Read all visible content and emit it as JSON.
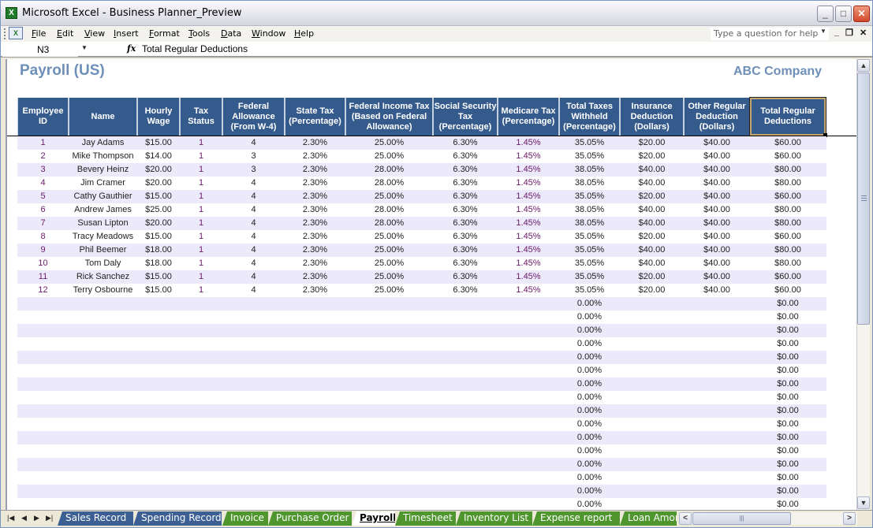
{
  "window": {
    "title": "Microsoft Excel - Business Planner_Preview",
    "minimize": "_",
    "maximize": "□",
    "close": "✕"
  },
  "menu": {
    "items": [
      {
        "key": "F",
        "rest": "ile"
      },
      {
        "key": "E",
        "rest": "dit"
      },
      {
        "key": "V",
        "rest": "iew"
      },
      {
        "key": "I",
        "rest": "nsert"
      },
      {
        "key": "F",
        "pre": "",
        "rest": "ormat",
        "display": "Format"
      },
      {
        "key": "T",
        "rest": "ools"
      },
      {
        "key": "D",
        "rest": "ata"
      },
      {
        "key": "W",
        "rest": "indow"
      },
      {
        "key": "H",
        "rest": "elp"
      }
    ],
    "help_placeholder": "Type a question for help",
    "mdi_min": "_",
    "mdi_restore": "🗗",
    "mdi_close": "✕"
  },
  "formula_bar": {
    "name_box": "N3",
    "fx": "fx",
    "content": "Total Regular Deductions"
  },
  "sheet": {
    "title": "Payroll (US)",
    "company": "ABC Company",
    "selected_cell": "N3",
    "colors": {
      "header_bg": "#355a8c",
      "title_color": "#6e8fb8",
      "band_color": "#ebe9fa"
    },
    "columns": [
      "Employee ID",
      "Name",
      "Hourly Wage",
      "Tax Status",
      "Federal Allowance (From W-4)",
      "State Tax (Percentage)",
      "Federal Income Tax (Based on Federal Allowance)",
      "Social Security Tax (Percentage)",
      "Medicare Tax (Percentage)",
      "Total Taxes Withheld (Percentage)",
      "Insurance Deduction (Dollars)",
      "Other Regular Deduction (Dollars)",
      "Total Regular Deductions"
    ],
    "rows": [
      [
        "1",
        "Jay Adams",
        "$15.00",
        "1",
        "4",
        "2.30%",
        "25.00%",
        "6.30%",
        "1.45%",
        "35.05%",
        "$20.00",
        "$40.00",
        "$60.00"
      ],
      [
        "2",
        "Mike Thompson",
        "$14.00",
        "1",
        "3",
        "2.30%",
        "25.00%",
        "6.30%",
        "1.45%",
        "35.05%",
        "$20.00",
        "$40.00",
        "$60.00"
      ],
      [
        "3",
        "Bevery Heinz",
        "$20.00",
        "1",
        "3",
        "2.30%",
        "28.00%",
        "6.30%",
        "1.45%",
        "38.05%",
        "$40.00",
        "$40.00",
        "$80.00"
      ],
      [
        "4",
        "Jim Cramer",
        "$20.00",
        "1",
        "4",
        "2.30%",
        "28.00%",
        "6.30%",
        "1.45%",
        "38.05%",
        "$40.00",
        "$40.00",
        "$80.00"
      ],
      [
        "5",
        "Cathy Gauthier",
        "$15.00",
        "1",
        "4",
        "2.30%",
        "25.00%",
        "6.30%",
        "1.45%",
        "35.05%",
        "$20.00",
        "$40.00",
        "$60.00"
      ],
      [
        "6",
        "Andrew James",
        "$25.00",
        "1",
        "4",
        "2.30%",
        "28.00%",
        "6.30%",
        "1.45%",
        "38.05%",
        "$40.00",
        "$40.00",
        "$80.00"
      ],
      [
        "7",
        "Susan Lipton",
        "$20.00",
        "1",
        "4",
        "2.30%",
        "28.00%",
        "6.30%",
        "1.45%",
        "38.05%",
        "$40.00",
        "$40.00",
        "$80.00"
      ],
      [
        "8",
        "Tracy Meadows",
        "$15.00",
        "1",
        "4",
        "2.30%",
        "25.00%",
        "6.30%",
        "1.45%",
        "35.05%",
        "$20.00",
        "$40.00",
        "$60.00"
      ],
      [
        "9",
        "Phil Beemer",
        "$18.00",
        "1",
        "4",
        "2.30%",
        "25.00%",
        "6.30%",
        "1.45%",
        "35.05%",
        "$40.00",
        "$40.00",
        "$80.00"
      ],
      [
        "10",
        "Tom Daly",
        "$18.00",
        "1",
        "4",
        "2.30%",
        "25.00%",
        "6.30%",
        "1.45%",
        "35.05%",
        "$40.00",
        "$40.00",
        "$80.00"
      ],
      [
        "11",
        "Rick Sanchez",
        "$15.00",
        "1",
        "4",
        "2.30%",
        "25.00%",
        "6.30%",
        "1.45%",
        "35.05%",
        "$20.00",
        "$40.00",
        "$60.00"
      ],
      [
        "12",
        "Terry Osbourne",
        "$15.00",
        "1",
        "4",
        "2.30%",
        "25.00%",
        "6.30%",
        "1.45%",
        "35.05%",
        "$20.00",
        "$40.00",
        "$60.00"
      ],
      [
        "",
        "",
        "",
        "",
        "",
        "",
        "",
        "",
        "",
        "0.00%",
        "",
        "",
        "$0.00"
      ],
      [
        "",
        "",
        "",
        "",
        "",
        "",
        "",
        "",
        "",
        "0.00%",
        "",
        "",
        "$0.00"
      ],
      [
        "",
        "",
        "",
        "",
        "",
        "",
        "",
        "",
        "",
        "0.00%",
        "",
        "",
        "$0.00"
      ],
      [
        "",
        "",
        "",
        "",
        "",
        "",
        "",
        "",
        "",
        "0.00%",
        "",
        "",
        "$0.00"
      ],
      [
        "",
        "",
        "",
        "",
        "",
        "",
        "",
        "",
        "",
        "0.00%",
        "",
        "",
        "$0.00"
      ],
      [
        "",
        "",
        "",
        "",
        "",
        "",
        "",
        "",
        "",
        "0.00%",
        "",
        "",
        "$0.00"
      ],
      [
        "",
        "",
        "",
        "",
        "",
        "",
        "",
        "",
        "",
        "0.00%",
        "",
        "",
        "$0.00"
      ],
      [
        "",
        "",
        "",
        "",
        "",
        "",
        "",
        "",
        "",
        "0.00%",
        "",
        "",
        "$0.00"
      ],
      [
        "",
        "",
        "",
        "",
        "",
        "",
        "",
        "",
        "",
        "0.00%",
        "",
        "",
        "$0.00"
      ],
      [
        "",
        "",
        "",
        "",
        "",
        "",
        "",
        "",
        "",
        "0.00%",
        "",
        "",
        "$0.00"
      ],
      [
        "",
        "",
        "",
        "",
        "",
        "",
        "",
        "",
        "",
        "0.00%",
        "",
        "",
        "$0.00"
      ],
      [
        "",
        "",
        "",
        "",
        "",
        "",
        "",
        "",
        "",
        "0.00%",
        "",
        "",
        "$0.00"
      ],
      [
        "",
        "",
        "",
        "",
        "",
        "",
        "",
        "",
        "",
        "0.00%",
        "",
        "",
        "$0.00"
      ],
      [
        "",
        "",
        "",
        "",
        "",
        "",
        "",
        "",
        "",
        "0.00%",
        "",
        "",
        "$0.00"
      ],
      [
        "",
        "",
        "",
        "",
        "",
        "",
        "",
        "",
        "",
        "0.00%",
        "",
        "",
        "$0.00"
      ],
      [
        "",
        "",
        "",
        "",
        "",
        "",
        "",
        "",
        "",
        "0.00%",
        "",
        "",
        "$0.00"
      ]
    ]
  },
  "tabs": {
    "nav": [
      "⏮",
      "◀",
      "▶",
      "⏭"
    ],
    "items": [
      {
        "label": "Sales Record",
        "color": "blue"
      },
      {
        "label": "Spending Record",
        "color": "blue"
      },
      {
        "label": "Invoice",
        "color": "green"
      },
      {
        "label": "Purchase Order",
        "color": "green"
      },
      {
        "label": "Payroll",
        "color": "active"
      },
      {
        "label": "Timesheet",
        "color": "green"
      },
      {
        "label": "Inventory List",
        "color": "green"
      },
      {
        "label": "Expense report",
        "color": "green"
      },
      {
        "label": "Loan Amor",
        "color": "green"
      }
    ],
    "scroll_left": "<",
    "scroll_right": ">",
    "scroll_thumb": "|||"
  },
  "scrollbar": {
    "up": "^",
    "down": "v"
  }
}
